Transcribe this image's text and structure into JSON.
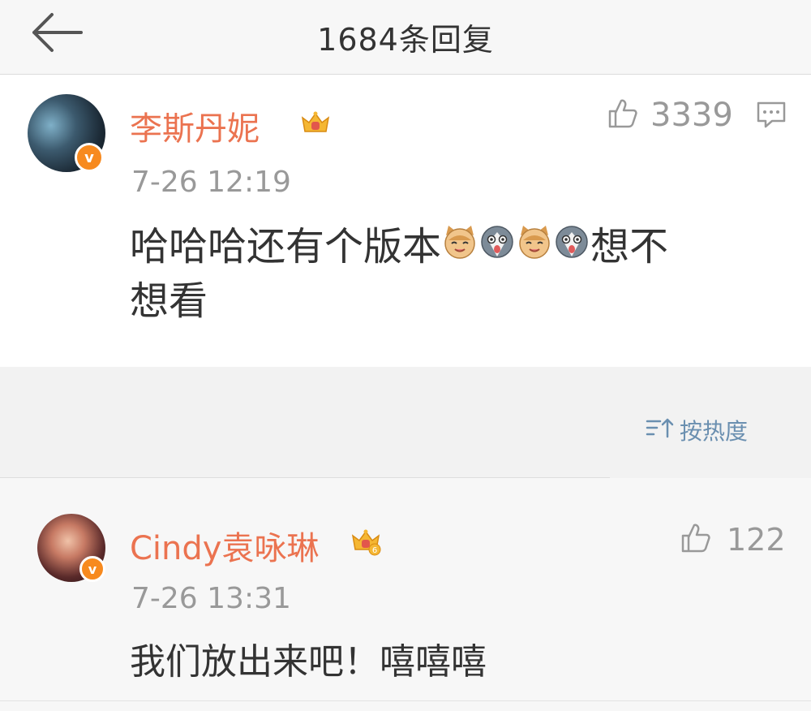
{
  "header": {
    "title": "1684条回复",
    "back_icon": "back-arrow-icon"
  },
  "main_comment": {
    "username": "李斯丹妮",
    "verified_badge": "v",
    "timestamp": "7-26 12:19",
    "like_count": "3339",
    "content_line1_text": "哈哈哈还有个版本",
    "content_line1_tail": "想不",
    "content_line2": "想看",
    "emojis": [
      "cat-emoji",
      "husky-emoji",
      "cat-emoji",
      "husky-emoji"
    ]
  },
  "sort": {
    "label": "按热度",
    "icon": "sort-icon"
  },
  "reply_comment": {
    "username": "Cindy袁咏琳",
    "verified_badge": "v",
    "crown_level": "6",
    "timestamp": "7-26 13:31",
    "like_count": "122",
    "content": "我们放出来吧！嘻嘻嘻"
  },
  "colors": {
    "username": "#eb7350",
    "timestamp": "#999999",
    "link": "#6a8fb0",
    "badge": "#f78a1f"
  }
}
